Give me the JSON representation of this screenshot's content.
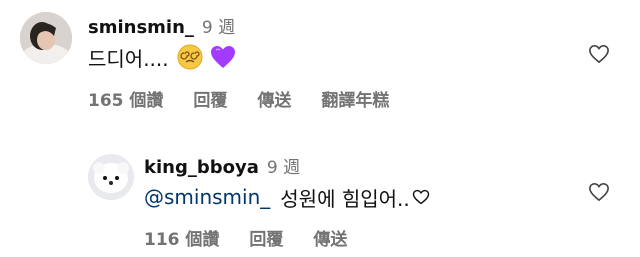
{
  "comments": [
    {
      "username": "sminsmin_",
      "time": "9 週",
      "text": "드디어....",
      "emojis": [
        "dizzy-face-emoji",
        "purple-heart-emoji"
      ],
      "actions": {
        "likes": "165 個讚",
        "reply": "回覆",
        "share": "傳送",
        "translate": "翻譯年糕"
      }
    },
    {
      "username": "king_bboya",
      "time": "9 週",
      "mention": "@sminsmin_",
      "text": "성원에 힘입어..",
      "trailing_icon": "outline-heart-icon",
      "actions": {
        "likes": "116 個讚",
        "reply": "回覆",
        "share": "傳送"
      }
    }
  ],
  "colors": {
    "mention": "#00376b",
    "secondary_text": "#737373",
    "purple_heart": "#a23bff",
    "emoji_face": "#f7c843"
  }
}
